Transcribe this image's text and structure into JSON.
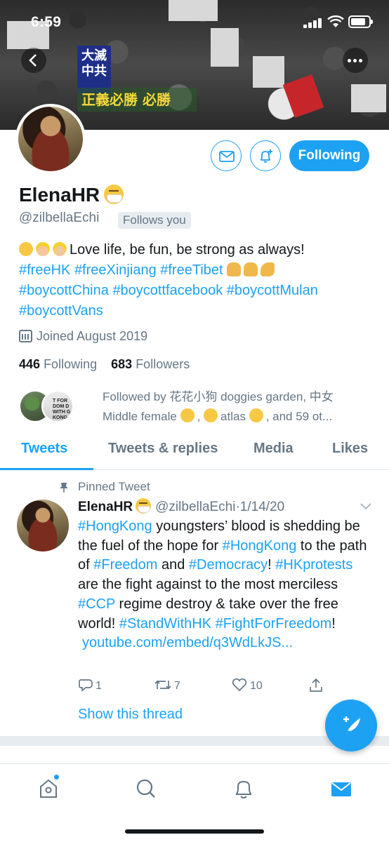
{
  "status_bar": {
    "time": "6:59"
  },
  "banner": {
    "sign_text": "大滅中共",
    "yellow_text": "正義必勝 必勝"
  },
  "profile": {
    "display_name": "ElenaHR",
    "handle": "@zilbellaEchi",
    "follows_you": "Follows you",
    "following_button": "Following",
    "bio_line1_text": "Love life, be fun, be strong as always!",
    "bio_hashtags_line2": [
      "#freeHK",
      "#freeXinjiang",
      "#freeTibet"
    ],
    "bio_hashtags_line3": [
      "#boycottChina",
      "#boycottfacebook",
      "#boycottMulan"
    ],
    "bio_hashtags_line4": [
      "#boycottVans"
    ],
    "joined": "Joined August 2019",
    "following_count": "446",
    "following_label": "Following",
    "followers_count": "683",
    "followers_label": "Followers",
    "followed_by_line1": "Followed by 花花小狗 doggies garden, 中女",
    "followed_by_line2": "Middle female",
    "followed_by_mid": ",",
    "followed_by_atlas": "atlas",
    "followed_by_end": ", and 59 ot...",
    "followed_avatar2_text": "T FOR DOM D WITH G KONG"
  },
  "tabs": [
    {
      "label": "Tweets",
      "active": true
    },
    {
      "label": "Tweets & replies",
      "active": false
    },
    {
      "label": "Media",
      "active": false
    },
    {
      "label": "Likes",
      "active": false
    }
  ],
  "tweet": {
    "pinned_label": "Pinned Tweet",
    "author_name": "ElenaHR",
    "author_handle": "@zilbellaEchi",
    "date": "·1/14/20",
    "body": [
      {
        "t": "#HongKong",
        "tag": true
      },
      {
        "t": " youngsters’ blood is shedding be the fuel of the hope for ",
        "tag": false
      },
      {
        "t": "#HongKong",
        "tag": true
      },
      {
        "t": " to the path of ",
        "tag": false
      },
      {
        "t": "#Freedom",
        "tag": true
      },
      {
        "t": " and ",
        "tag": false
      },
      {
        "t": "#Democracy",
        "tag": true
      },
      {
        "t": "! ",
        "tag": false
      },
      {
        "t": "#HKprotests",
        "tag": true
      },
      {
        "t": " are the fight against to the most merciless ",
        "tag": false
      },
      {
        "t": "#CCP",
        "tag": true
      },
      {
        "t": " regime destroy & take over the free world! ",
        "tag": false
      },
      {
        "t": "#StandWithHK",
        "tag": true
      },
      {
        "t": " ",
        "tag": false
      },
      {
        "t": "#FightForFreedom",
        "tag": true
      },
      {
        "t": "!",
        "tag": false
      }
    ],
    "link": "youtube.com/embed/q3WdLkJS...",
    "reply_count": "1",
    "retweet_count": "7",
    "like_count": "10",
    "show_thread": "Show this thread"
  },
  "colors": {
    "accent": "#1da1f2",
    "text": "#14171a",
    "muted": "#657786"
  },
  "icons": [
    "back-icon",
    "more-icon",
    "mail-icon",
    "bell-plus-icon",
    "calendar-icon",
    "pin-icon",
    "chevron-down-icon",
    "reply-icon",
    "retweet-icon",
    "heart-icon",
    "share-icon",
    "compose-icon",
    "home-icon",
    "search-icon",
    "bell-icon",
    "mail-nav-icon"
  ]
}
